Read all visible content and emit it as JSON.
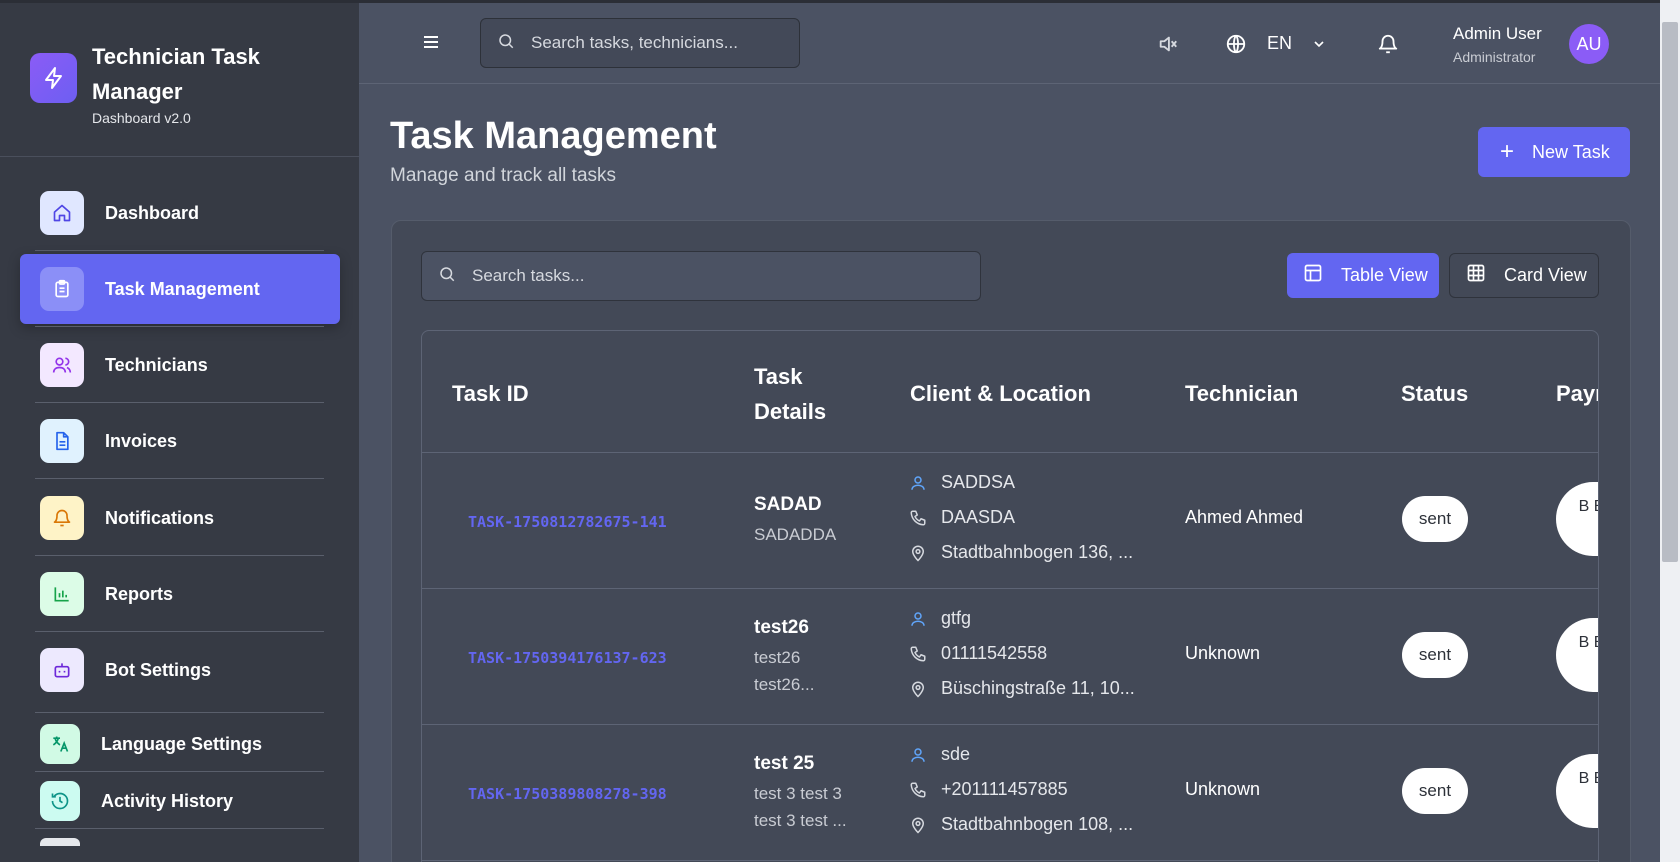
{
  "brand": {
    "title": "Technician Task Manager",
    "subtitle": "Dashboard v2.0",
    "icon": "lightning-icon"
  },
  "sidebar": {
    "items": [
      {
        "label": "Dashboard",
        "icon": "home-icon",
        "bg": "#e0e7ff",
        "color": "#4f46e5"
      },
      {
        "label": "Task Management",
        "icon": "clipboard-icon",
        "bg": "#8b8ff7",
        "color": "#ffffff",
        "active": true
      },
      {
        "label": "Technicians",
        "icon": "users-icon",
        "bg": "#f3e8ff",
        "color": "#9333ea"
      },
      {
        "label": "Invoices",
        "icon": "document-icon",
        "bg": "#e0f2fe",
        "color": "#2563eb"
      },
      {
        "label": "Notifications",
        "icon": "bell-icon",
        "bg": "#fef3c7",
        "color": "#d97706"
      },
      {
        "label": "Reports",
        "icon": "bar-chart-icon",
        "bg": "#dcfce7",
        "color": "#16a34a"
      },
      {
        "label": "Bot Settings",
        "icon": "bot-icon",
        "bg": "#ede9fe",
        "color": "#6d28d9"
      },
      {
        "label": "Language Settings",
        "icon": "translate-icon",
        "bg": "#d1fae5",
        "color": "#059669"
      },
      {
        "label": "Activity History",
        "icon": "history-icon",
        "bg": "#ccfbf1",
        "color": "#0d9488"
      }
    ]
  },
  "header": {
    "search_placeholder": "Search tasks, technicians...",
    "language": "EN",
    "user_name": "Admin User",
    "user_role": "Administrator",
    "avatar_initials": "AU"
  },
  "page": {
    "title": "Task Management",
    "subtitle": "Manage and track all tasks",
    "new_task_label": "New Task",
    "task_search_placeholder": "Search tasks...",
    "table_view_label": "Table View",
    "card_view_label": "Card View"
  },
  "table": {
    "columns": [
      "Task ID",
      "Task Details",
      "Client & Location",
      "Technician",
      "Status",
      "Payment"
    ],
    "rows": [
      {
        "id": "TASK-1750812782675-141",
        "title": "SADAD",
        "desc": "SADADDA",
        "client": "SADDSA",
        "phone": "DAASDA",
        "address": "Stadtbahnbogen 136, ...",
        "technician": "Ahmed Ahmed",
        "status": "sent",
        "payment": "B Be"
      },
      {
        "id": "TASK-1750394176137-623",
        "title": "test26",
        "desc": "test26 test26...",
        "client": "gtfg",
        "phone": "01111542558",
        "address": "Büschingstraße 11, 10...",
        "technician": "Unknown",
        "status": "sent",
        "payment": "B Be"
      },
      {
        "id": "TASK-1750389808278-398",
        "title": "test 25",
        "desc": "test 3 test 3 test 3 test ...",
        "client": "sde",
        "phone": "+201111457885",
        "address": "Stadtbahnbogen 108, ...",
        "technician": "Unknown",
        "status": "sent",
        "payment": "B Be"
      }
    ]
  },
  "colors": {
    "accent": "#6366f1",
    "sidebar_bg": "#363a44",
    "main_bg": "#4b5263"
  }
}
